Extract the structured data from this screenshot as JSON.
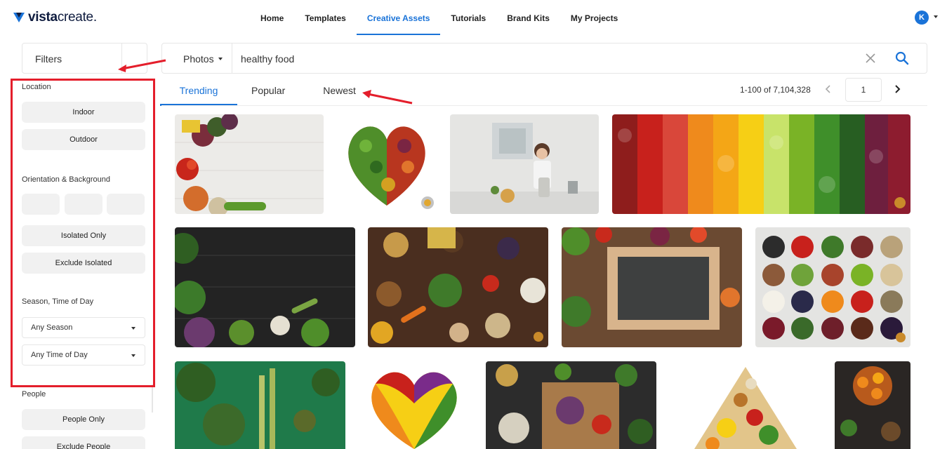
{
  "app": {
    "logo_bold": "vista",
    "logo_light": "create",
    "logo_suffix": "."
  },
  "nav": {
    "items": [
      {
        "label": "Home"
      },
      {
        "label": "Templates"
      },
      {
        "label": "Creative Assets",
        "active": true
      },
      {
        "label": "Tutorials"
      },
      {
        "label": "Brand Kits"
      },
      {
        "label": "My Projects"
      }
    ]
  },
  "user": {
    "initial": "K"
  },
  "filters": {
    "label": "Filters",
    "location": {
      "title": "Location",
      "options": [
        "Indoor",
        "Outdoor"
      ]
    },
    "orientation": {
      "title": "Orientation & Background",
      "options": [
        "Isolated Only",
        "Exclude Isolated"
      ]
    },
    "season": {
      "title": "Season, Time of Day",
      "season_value": "Any Season",
      "time_value": "Any Time of Day"
    },
    "people": {
      "title": "People",
      "options": [
        "People Only",
        "Exclude People"
      ]
    }
  },
  "search": {
    "type": "Photos",
    "query": "healthy food"
  },
  "tabs": {
    "trending": "Trending",
    "popular": "Popular",
    "newest": "Newest",
    "active": "Trending"
  },
  "pagination": {
    "results": "1-100 of 7,104,328",
    "page": "1"
  },
  "colors": {
    "accent": "#1a73d8",
    "annotation": "#e41e2b"
  },
  "icons": [
    "logo-icon",
    "caret-down-icon",
    "close-icon",
    "search-icon",
    "chevron-left-icon",
    "chevron-right-icon",
    "premium-badge-icon"
  ]
}
